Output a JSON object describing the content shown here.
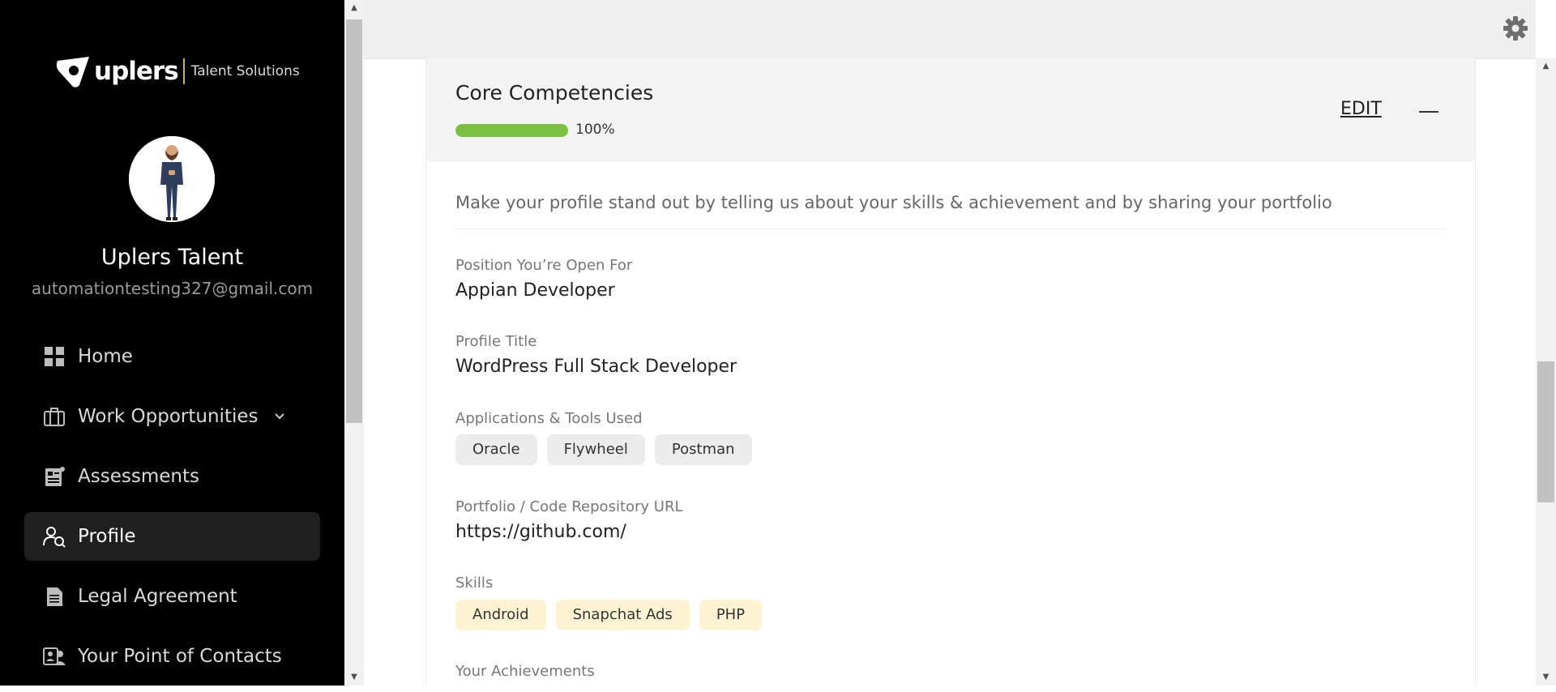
{
  "brand": {
    "name": "uplers",
    "subtitle": "Talent Solutions"
  },
  "user": {
    "name": "Uplers Talent",
    "email": "automationtesting327@gmail.com"
  },
  "nav": {
    "items": [
      {
        "label": "Home",
        "icon": "grid-icon"
      },
      {
        "label": "Work Opportunities",
        "icon": "briefcase-icon",
        "has_dropdown": true
      },
      {
        "label": "Assessments",
        "icon": "assessment-icon"
      },
      {
        "label": "Profile",
        "icon": "profile-search-icon",
        "active": true
      },
      {
        "label": "Legal Agreement",
        "icon": "document-icon"
      },
      {
        "label": "Your Point of Contacts",
        "icon": "contacts-icon"
      }
    ]
  },
  "section": {
    "title": "Core Competencies",
    "progress": 100,
    "progress_label": "100%",
    "edit_label": "EDIT",
    "intro": "Make your profile stand out by telling us about your skills & achievement and by sharing your portfolio"
  },
  "fields": {
    "position": {
      "label": "Position You’re Open For",
      "value": "Appian Developer"
    },
    "profile_title": {
      "label": "Profile Title",
      "value": "WordPress Full Stack Developer"
    },
    "tools": {
      "label": "Applications & Tools Used",
      "items": [
        "Oracle",
        "Flywheel",
        "Postman"
      ]
    },
    "portfolio": {
      "label": "Portfolio / Code Repository URL",
      "value": "https://github.com/"
    },
    "skills": {
      "label": "Skills",
      "items": [
        "Android",
        "Snapchat Ads",
        "PHP"
      ]
    },
    "achievements": {
      "label": "Your Achievements"
    }
  },
  "colors": {
    "progress": "#7ac142",
    "skill_tag": "#fdf3d3",
    "tool_tag": "#ececec",
    "sidebar": "#000000"
  }
}
